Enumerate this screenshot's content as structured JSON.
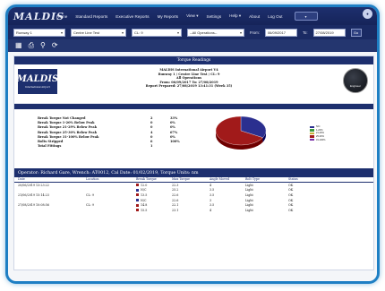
{
  "nav": {
    "logo": "MALDIS",
    "items": [
      "Home",
      "Standard Reports",
      "Executive Reports",
      "My Reports",
      "View ▾",
      "Settings",
      "Help ▾",
      "About",
      "Log Out"
    ],
    "button": "▾",
    "badge": "●"
  },
  "filters": {
    "runway": "Runway 1",
    "runway_type": "Centre Line Test",
    "line": "CL: 9",
    "operation": "--All Operations--",
    "from_label": "From:",
    "from_value": "06/09/2017",
    "to_label": "To:",
    "to_value": "27/08/2019",
    "go": "Go"
  },
  "toolbar": {
    "icons": [
      "grid-icon",
      "print-icon",
      "search-icon",
      "refresh-icon"
    ]
  },
  "report": {
    "title": "Torque Readings",
    "airport_logo": "MALDIS",
    "airport_logo_sub": "International Airport",
    "header_lines": [
      "MALDIS International Airport V4",
      "Runway 1 / Centre Line Test / CL: 9",
      "All Operations",
      "From: 06/09/2017 To: 27/08/2019",
      "Report Prepared: 27/08/2019 13:41:31 (Week 35)"
    ],
    "seal_text": "Engineer",
    "stats": [
      {
        "label": "Break Torque Not Changed",
        "count": "2",
        "pct": "33%"
      },
      {
        "label": "Break Torque 1-20% Below Peak",
        "count": "0",
        "pct": "0%"
      },
      {
        "label": "Break Torque 21-29% Below Peak",
        "count": "0",
        "pct": "0%"
      },
      {
        "label": "Break Torque 25-30% Below Peak",
        "count": "4",
        "pct": "67%"
      },
      {
        "label": "Break Torque 31-100% Below Peak",
        "count": "0",
        "pct": "0%"
      },
      {
        "label": "Bolts Stripped",
        "count": "6",
        "pct": "100%"
      },
      {
        "label": "Total Fittings",
        "count": "1",
        "pct": ""
      }
    ],
    "operator_line": "Operator: Richard Gare, Wrench: AT0012, Cal Date: 01/02/2019, Torque Units: nm",
    "columns": [
      "Date",
      "Location",
      "Break Torque",
      "Max Torque",
      "Angle Moved",
      "Bolt Type",
      "Status"
    ],
    "rows": [
      {
        "date": "20/06/2019 13:23:22",
        "location": "",
        "brake": "12.0",
        "max": "22.3",
        "avg": "4",
        "type": "Light",
        "status": "OK"
      },
      {
        "date": "",
        "location": "",
        "brake": "N/C",
        "max": "25.2",
        "avg": "3.5",
        "type": "Light",
        "status": "OK"
      },
      {
        "date": "21/06/2019 15:14:23",
        "location": "CL: 9",
        "brake": "13.5",
        "max": "22.6",
        "avg": "3.5",
        "type": "Light",
        "status": "OK"
      },
      {
        "date": "",
        "location": "",
        "brake": "N/C",
        "max": "22.6",
        "avg": "3",
        "type": "Light",
        "status": "OK"
      },
      {
        "date": "27/08/2019 10:08:56",
        "location": "CL: 9",
        "brake": "14.8",
        "max": "22.1",
        "avg": "3.5",
        "type": "Light",
        "status": "OK"
      },
      {
        "date": "",
        "location": "",
        "brake": "15.5",
        "max": "23.1",
        "avg": "4",
        "type": "Light",
        "status": "OK"
      }
    ]
  },
  "chart_data": {
    "type": "pie",
    "slices": [
      {
        "name": "N/C",
        "value": 33,
        "color": "#2b2f8f"
      },
      {
        "name": "1-20%",
        "value": 0,
        "color": "#3d9b3d"
      },
      {
        "name": "21-29%",
        "value": 0,
        "color": "#c9b23a"
      },
      {
        "name": "25-30%",
        "value": 67,
        "color": "#a11a1a"
      },
      {
        "name": "31-100%",
        "value": 0,
        "color": "#7a2fa8"
      }
    ]
  },
  "colors": {
    "accent": "#1d2f6e",
    "frame": "#1e7fc4"
  }
}
